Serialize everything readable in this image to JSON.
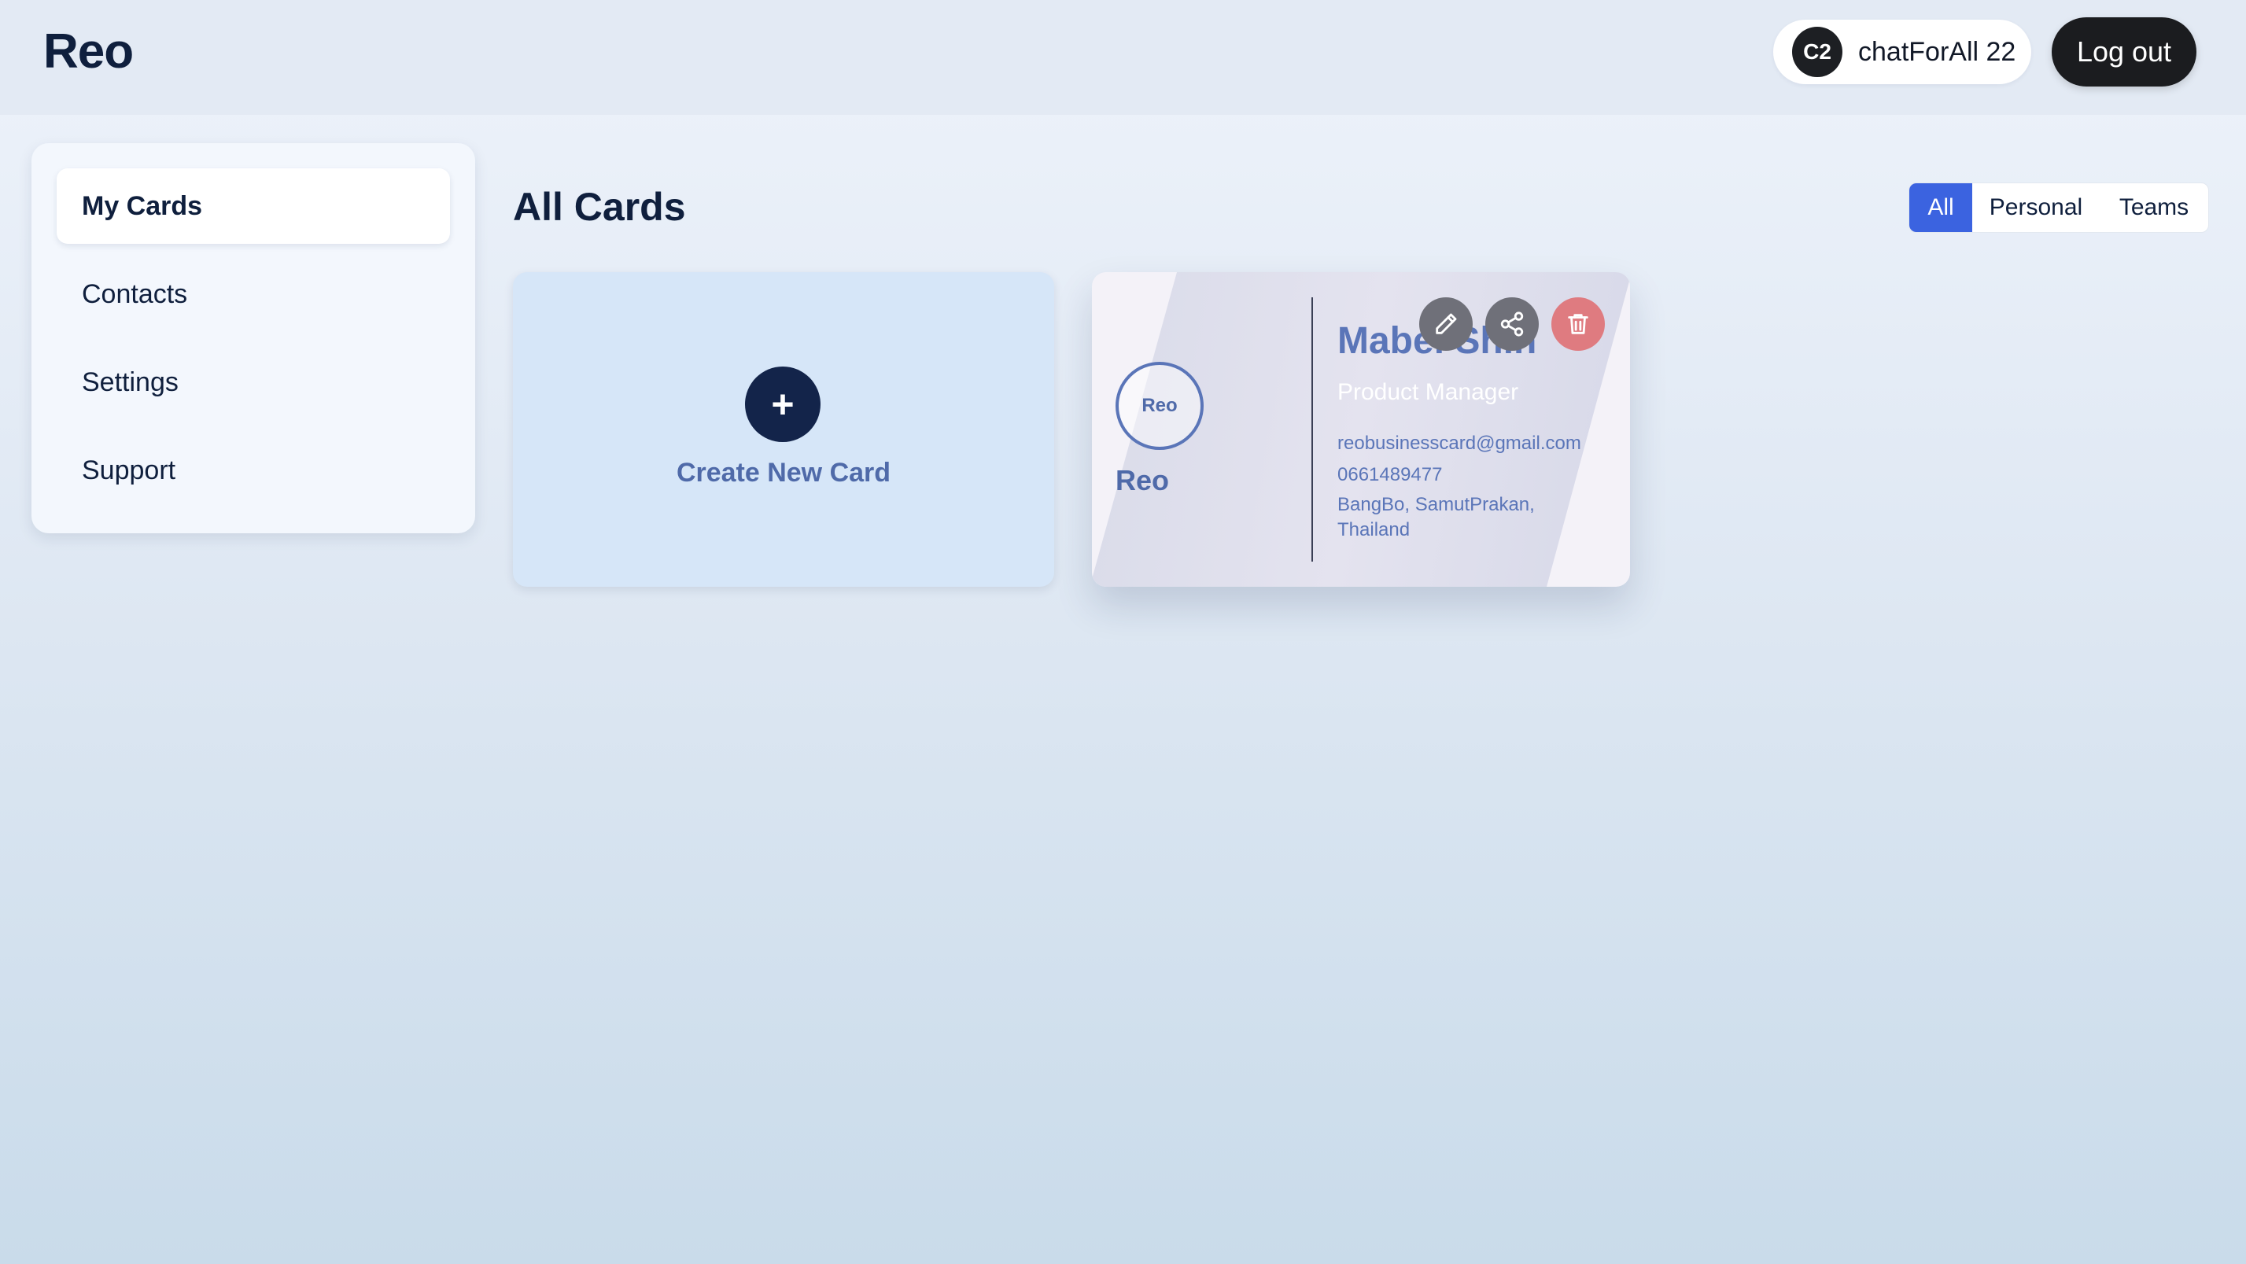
{
  "header": {
    "logo": "Reo",
    "user": {
      "initials": "C2",
      "name": "chatForAll 22"
    },
    "logout_label": "Log out"
  },
  "sidebar": {
    "items": [
      {
        "label": "My Cards",
        "active": true
      },
      {
        "label": "Contacts",
        "active": false
      },
      {
        "label": "Settings",
        "active": false
      },
      {
        "label": "Support",
        "active": false
      }
    ]
  },
  "main": {
    "title": "All Cards",
    "filters": [
      {
        "label": "All",
        "selected": true
      },
      {
        "label": "Personal",
        "selected": false
      },
      {
        "label": "Teams",
        "selected": false
      }
    ],
    "create_card": {
      "icon": "plus-icon",
      "label": "Create New Card"
    },
    "cards": [
      {
        "logo_text": "Reo",
        "brand": "Reo",
        "name": "Mabel Shin",
        "job_title": "Product Manager",
        "email": "reobusinesscard@gmail.com",
        "phone": "0661489477",
        "address": "BangBo, SamutPrakan, Thailand",
        "actions": [
          "pencil-icon",
          "share-icon",
          "trash-icon"
        ]
      }
    ]
  },
  "colors": {
    "accent": "#3b63e0",
    "dark": "#13244a",
    "card_text": "#5a75b8",
    "delete": "#df7b80"
  }
}
